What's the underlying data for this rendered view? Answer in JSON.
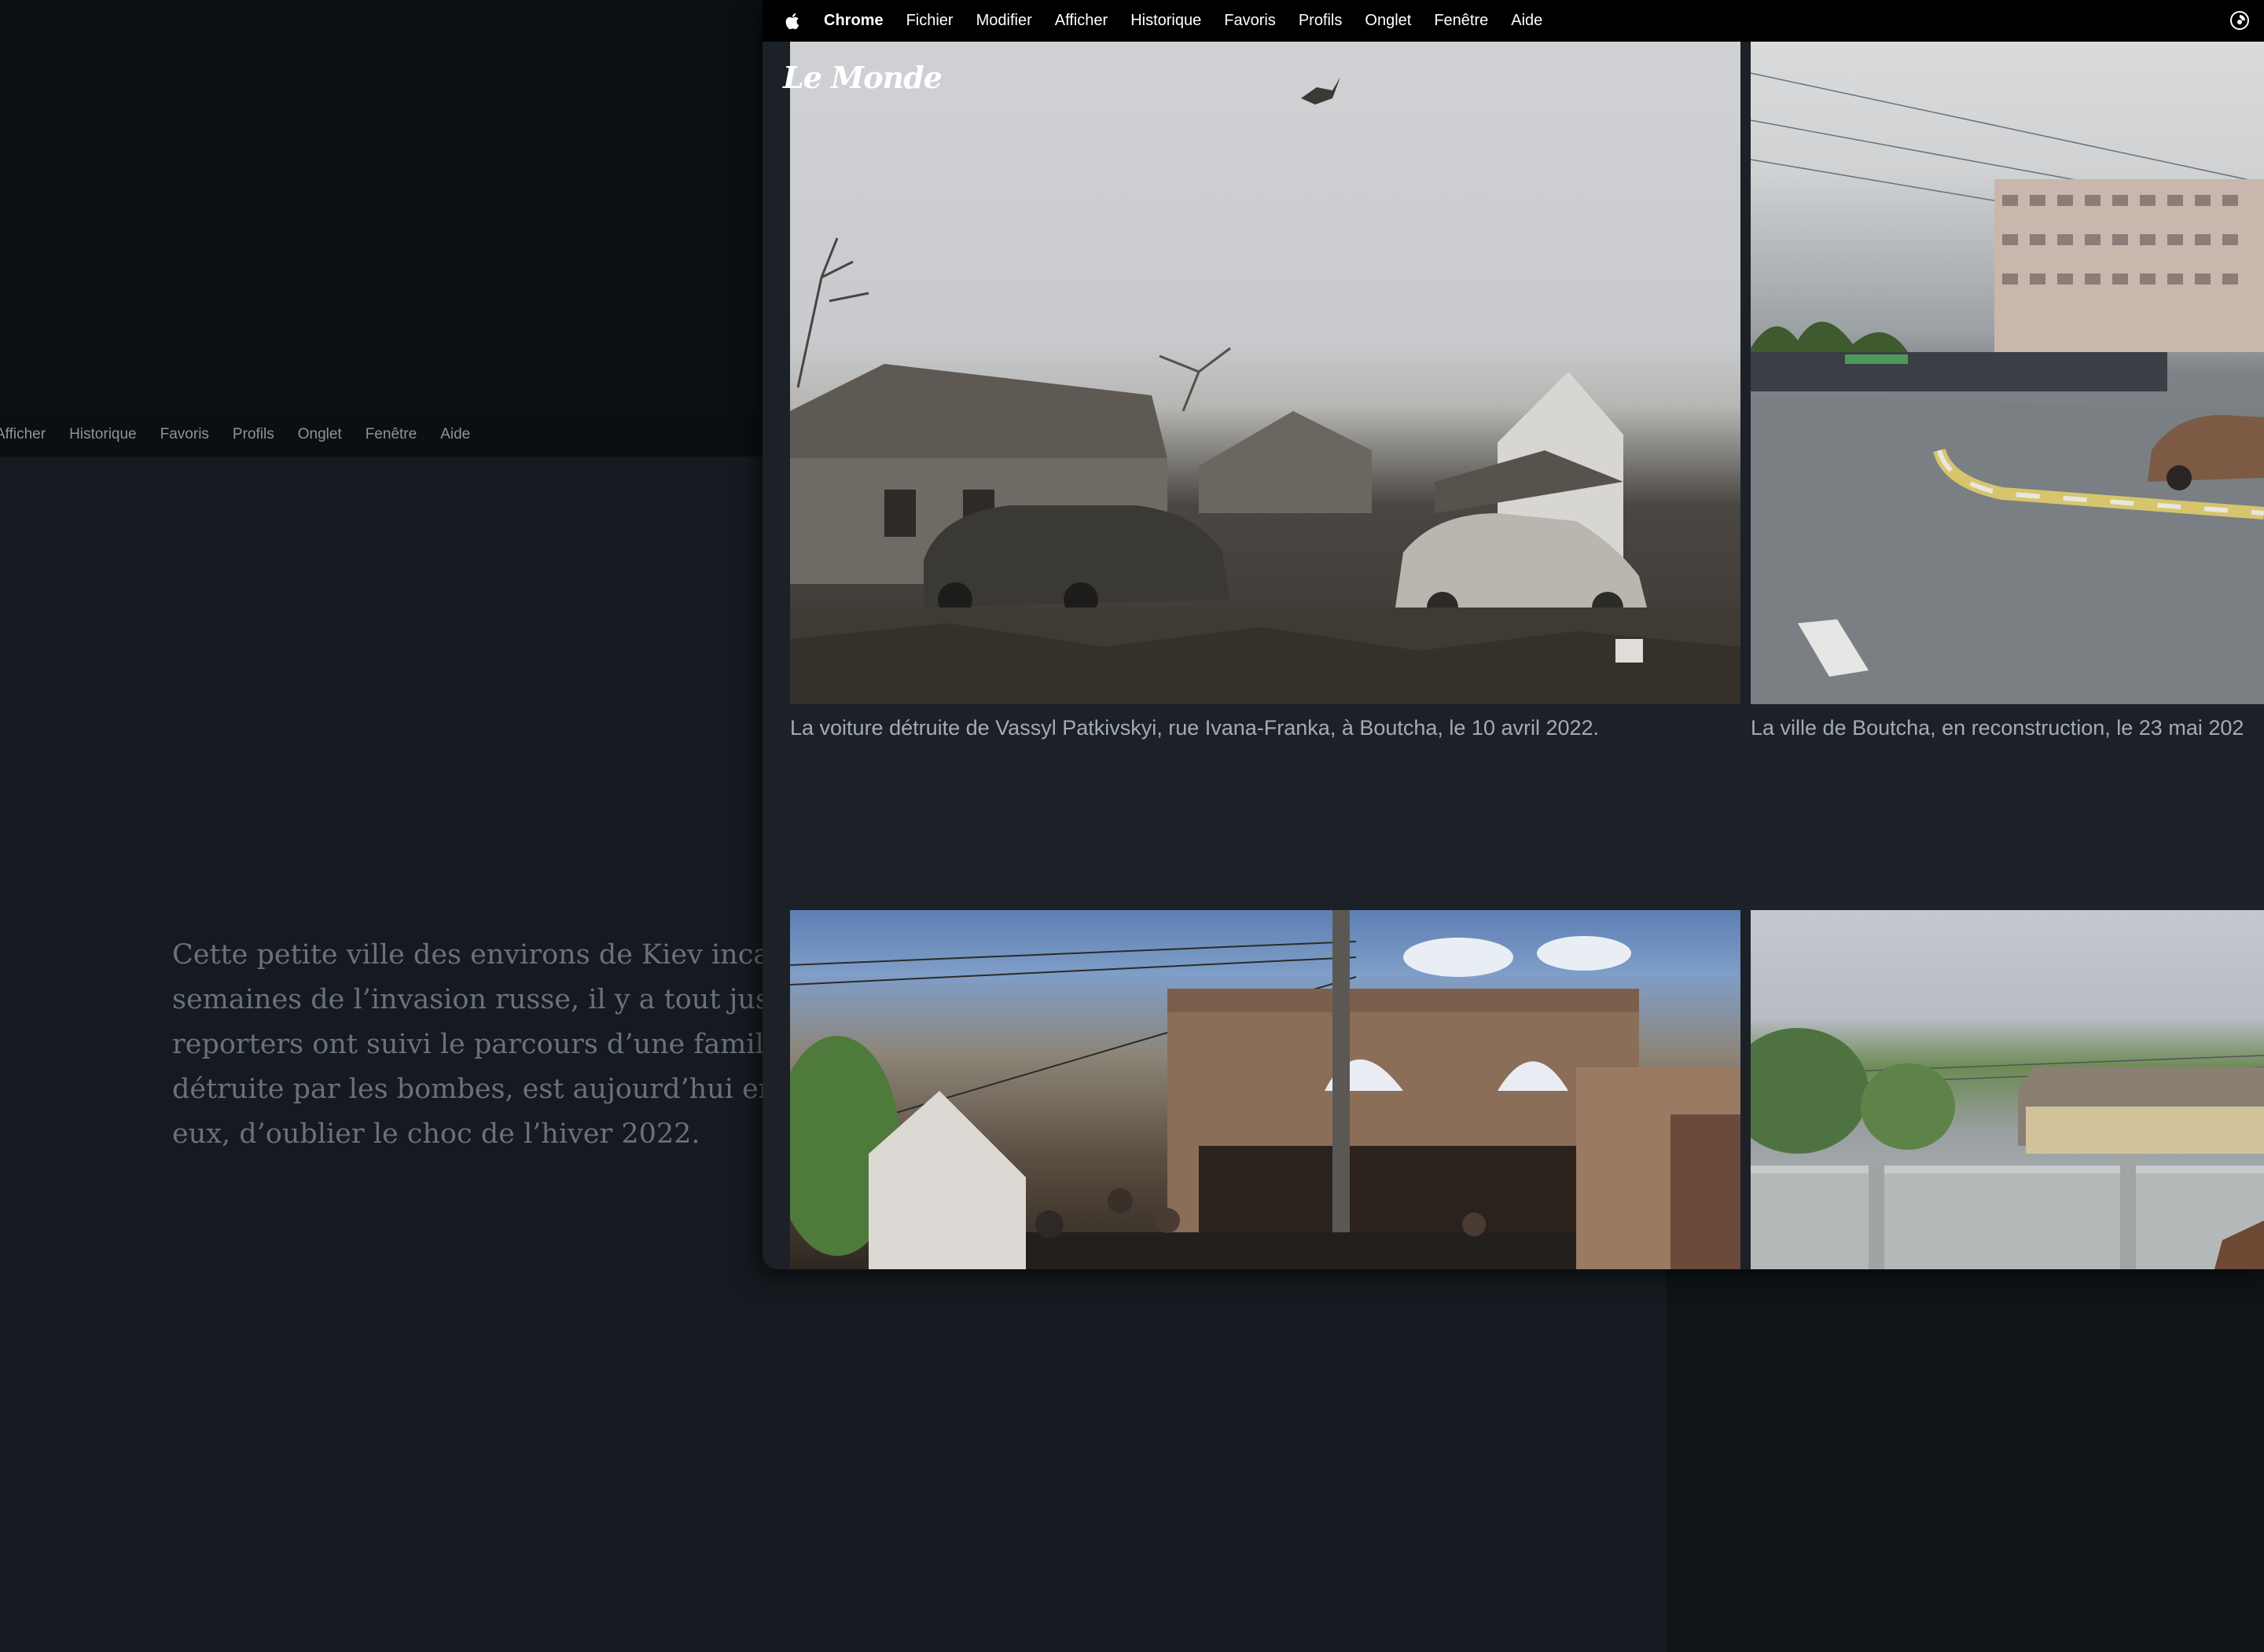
{
  "background_window": {
    "menu_items": [
      "Afficher",
      "Historique",
      "Favoris",
      "Profils",
      "Onglet",
      "Fenêtre",
      "Aide"
    ],
    "paragraph_lines": [
      "Cette petite ville des environs de Kiev incarn",
      "semaines de l’invasion russe, il y a tout juste",
      "reporters ont suivi le parcours d’une famille",
      "détruite par les bombes, est aujourd’hui en r",
      "eux, d’oublier le choc de l’hiver 2022."
    ]
  },
  "menubar": {
    "app_name": "Chrome",
    "items": [
      "Fichier",
      "Modifier",
      "Afficher",
      "Historique",
      "Favoris",
      "Profils",
      "Onglet",
      "Fenêtre",
      "Aide"
    ]
  },
  "page": {
    "logo": "Le Monde",
    "gallery": [
      {
        "caption": "La voiture détruite de Vassyl Patkivskyi, rue Ivana-Franka, à Boutcha, le 10 avril 2022."
      },
      {
        "caption": "La ville de Boutcha, en reconstruction, le 23 mai 202"
      }
    ]
  }
}
